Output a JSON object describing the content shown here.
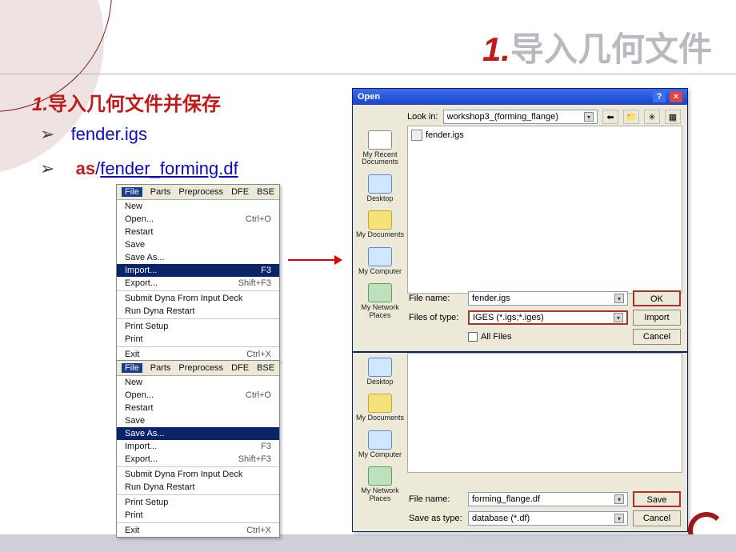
{
  "header": {
    "num": "1.",
    "title": "导入几何文件"
  },
  "subtitle": {
    "num": "1.",
    "text": "导入几何文件并保存"
  },
  "bullets": {
    "a": "fender.igs",
    "b_strong": "as",
    "b_sep": "/",
    "b_text": "fender_forming.df"
  },
  "menubar": [
    "File",
    "Parts",
    "Preprocess",
    "DFE",
    "BSE"
  ],
  "menu1": [
    {
      "label": "New",
      "sc": ""
    },
    {
      "label": "Open...",
      "sc": "Ctrl+O"
    },
    {
      "label": "Restart",
      "sc": ""
    },
    {
      "label": "Save",
      "sc": ""
    },
    {
      "label": "Save As...",
      "sc": ""
    },
    {
      "label": "Import...",
      "sc": "F3",
      "hl": true
    },
    {
      "label": "Export...",
      "sc": "Shift+F3"
    },
    {
      "label": "Submit Dyna From Input Deck",
      "sc": ""
    },
    {
      "label": "Run Dyna Restart",
      "sc": ""
    },
    {
      "label": "Print Setup",
      "sc": ""
    },
    {
      "label": "Print",
      "sc": ""
    },
    {
      "label": "Exit",
      "sc": "Ctrl+X"
    }
  ],
  "menu2": [
    {
      "label": "New",
      "sc": ""
    },
    {
      "label": "Open...",
      "sc": "Ctrl+O"
    },
    {
      "label": "Restart",
      "sc": ""
    },
    {
      "label": "Save",
      "sc": ""
    },
    {
      "label": "Save As...",
      "sc": "",
      "hl": true
    },
    {
      "label": "Import...",
      "sc": "F3"
    },
    {
      "label": "Export...",
      "sc": "Shift+F3"
    },
    {
      "label": "Submit Dyna From Input Deck",
      "sc": ""
    },
    {
      "label": "Run Dyna Restart",
      "sc": ""
    },
    {
      "label": "Print Setup",
      "sc": ""
    },
    {
      "label": "Print",
      "sc": ""
    },
    {
      "label": "Exit",
      "sc": "Ctrl+X"
    }
  ],
  "dlg_open": {
    "title": "Open",
    "lookin_label": "Look in:",
    "lookin_value": "workshop3_(forming_flange)",
    "file_in_list": "fender.igs",
    "sidebar": [
      "My Recent Documents",
      "Desktop",
      "My Documents",
      "My Computer",
      "My Network Places"
    ],
    "filename_label": "File name:",
    "filename_value": "fender.igs",
    "filetype_label": "Files of type:",
    "filetype_value": "IGES (*.igs;*.iges)",
    "allfiles_label": "All Files",
    "btn_ok": "OK",
    "btn_import": "Import",
    "btn_cancel": "Cancel"
  },
  "dlg_save": {
    "sidebar": [
      "Desktop",
      "My Documents",
      "My Computer",
      "My Network Places"
    ],
    "filename_label": "File name:",
    "filename_value": "forming_flange.df",
    "savetype_label": "Save as type:",
    "savetype_value": "database (*.df)",
    "btn_save": "Save",
    "btn_cancel": "Cancel"
  }
}
